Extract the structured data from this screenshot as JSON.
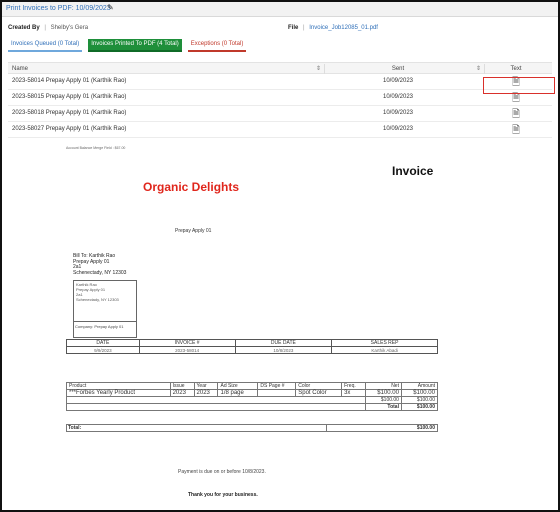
{
  "window": {
    "title": "Print Invoices to PDF: 10/09/2023"
  },
  "meta": {
    "created_by_label": "Created By",
    "created_by_value": "Shelby's Gera",
    "file_label": "File",
    "file_value": "Invoice_Job12085_01.pdf"
  },
  "tabs": [
    {
      "label": "Invoices Queued (0 Total)"
    },
    {
      "label": "Invoices Printed To PDF (4 Total)"
    },
    {
      "label": "Exceptions (0 Total)"
    }
  ],
  "grid": {
    "columns": {
      "name": "Name",
      "sent": "Sent",
      "text": "Text"
    },
    "rows": [
      {
        "name": "2023-58014 Prepay Apply 01 (Karthik Rao)",
        "sent": "10/09/2023"
      },
      {
        "name": "2023-58015 Prepay Apply 01 (Karthik Rao)",
        "sent": "10/09/2023"
      },
      {
        "name": "2023-58018 Prepay Apply 01 (Karthik Rao)",
        "sent": "10/09/2023"
      },
      {
        "name": "2023-58027 Prepay Apply 01 (Karthik Rao)",
        "sent": "10/09/2023"
      }
    ]
  },
  "preview": {
    "note": "Account Balance Merge Field : $67.00",
    "heading": "Invoice",
    "company": "Organic Delights",
    "subtitle": "Prepay Apply 01",
    "bill_to": [
      "Bill To: Karthik Rao",
      "Prepay Apply 01",
      "2a1",
      "Schenectady, NY 12303"
    ],
    "addr_box": [
      "Karthik Rao",
      "Prepay Apply 01",
      "2a1",
      "Schenectady, NY 12303"
    ],
    "addr_company": "Company: Prepay Apply 01",
    "details": {
      "headers": [
        "DATE",
        "INVOICE #",
        "DUE DATE",
        "SALES REP"
      ],
      "values": [
        "9/9/2023",
        "2023-58014",
        "10/8/2023",
        "Karthik Abadi"
      ]
    },
    "products": {
      "headers": [
        "Product",
        "Issue",
        "Year",
        "Ad Size",
        "DS Page #",
        "Color",
        "Freq.",
        "Net",
        "Amount"
      ],
      "row": [
        "***Forbes Yearly Product",
        "2023",
        "2023",
        "1/8 page",
        "",
        "Spot Color",
        "3x",
        "$100.00",
        "$100.00"
      ],
      "sub_net": "$100.00",
      "sub_amount": "$100.00",
      "total_label": "Total",
      "total_amount": "$100.00"
    },
    "grand_total_label": "Total:",
    "grand_total_amount": "$100.00",
    "payment_note": "Payment is due on or before 10/8/2023.",
    "thanks": "Thank you for your business."
  }
}
